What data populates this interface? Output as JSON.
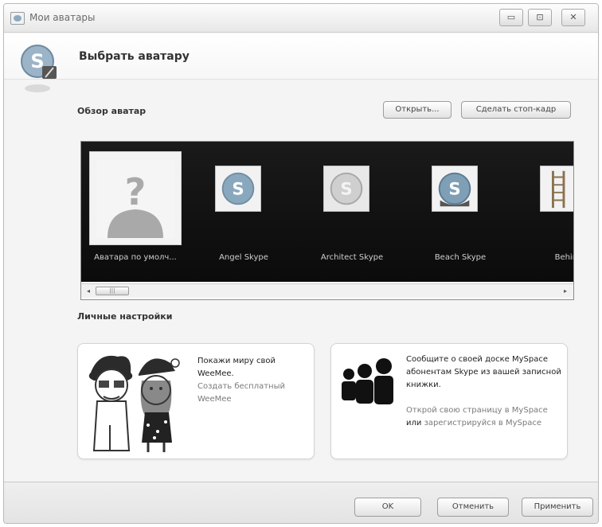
{
  "window": {
    "title": "Мои аватары",
    "controls": {
      "minimize": "▭",
      "maximize": "⊡",
      "close": "✕"
    }
  },
  "header": {
    "title": "Выбрать аватару",
    "icon": "skype-logo-icon"
  },
  "browse": {
    "title": "Обзор аватар",
    "open_button": "Открыть...",
    "snapshot_button": "Сделать стоп-кадр",
    "avatars": [
      {
        "label": "Аватара по умолч...",
        "icon": "default-avatar-icon",
        "selected": true
      },
      {
        "label": "Angel Skype",
        "icon": "skype-avatar-icon",
        "selected": false
      },
      {
        "label": "Architect Skype",
        "icon": "skype-avatar-icon",
        "selected": false
      },
      {
        "label": "Beach Skype",
        "icon": "skype-avatar-icon",
        "selected": false
      },
      {
        "label": "Behind",
        "icon": "ladder-avatar-icon",
        "selected": false
      }
    ],
    "scrollbar": {
      "left_arrow": "◂",
      "right_arrow": "▸",
      "thumb": "|||"
    }
  },
  "personal": {
    "title": "Личные настройки",
    "weemee": {
      "heading": "Покажи миру свой WeeMee.",
      "link": "Создать бесплатный WeeMee"
    },
    "myspace": {
      "heading": "Сообщите о своей доске MySpace абонентам Skype из вашей записной книжки.",
      "link_pre": "Открой свою страницу в MySpace",
      "link_mid": "или",
      "link_post": "зарегистрируйся в MySpace"
    }
  },
  "footer": {
    "ok_button": "OK",
    "cancel_button": "Отменить",
    "apply_button": "Применить"
  },
  "colors": {
    "gallery_background": "#101010",
    "skype_blue": "#7fa6c2",
    "window_background": "#f4f4f4"
  }
}
